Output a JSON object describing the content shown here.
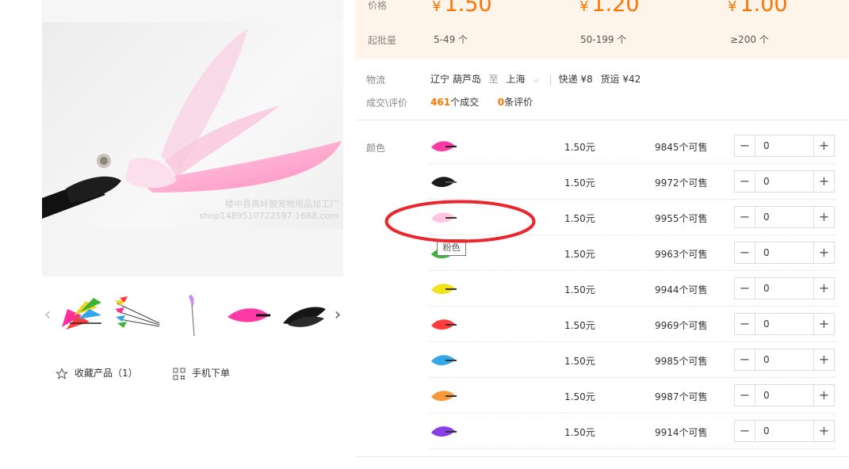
{
  "gallery": {
    "watermark_line1": "楼中县高岭狼宠物用品加工厂",
    "watermark_line2": "shop1489510722597.1688.com",
    "thumbnails": [
      {
        "name": "thumb-feather-bunch-pink"
      },
      {
        "name": "thumb-feather-bunch-mixed"
      },
      {
        "name": "thumb-feather-white"
      },
      {
        "name": "thumb-feather-pink"
      },
      {
        "name": "thumb-feather-black"
      }
    ]
  },
  "actions": {
    "favorite_label": "收藏产品（1）",
    "mobile_order_label": "手机下单"
  },
  "price_block": {
    "price_label": "价格",
    "moq_label": "起批量",
    "yen_symbol": "¥",
    "tiers": [
      {
        "price": "1.50",
        "range": "5-49 个"
      },
      {
        "price": "1.20",
        "range": "50-199 个"
      },
      {
        "price": "1.00",
        "range": "≥200 个"
      }
    ]
  },
  "logistics": {
    "label": "物流",
    "origin": "辽宁 葫芦岛",
    "to": "至",
    "destination": "上海",
    "express": "快递 ¥8",
    "freight": "货运 ¥42"
  },
  "deals": {
    "label": "成交\\评价",
    "count": "461",
    "count_suffix": "个成交",
    "reviews": "0",
    "reviews_suffix": "条评价"
  },
  "sku": {
    "label": "颜色",
    "tooltip": "粉色",
    "plus": "+",
    "minus": "−",
    "rows": [
      {
        "price": "1.50元",
        "stock": "9845个可售",
        "qty": "0",
        "color": "#ff3aa6",
        "tip": "#222"
      },
      {
        "price": "1.50元",
        "stock": "9972个可售",
        "qty": "0",
        "color": "#1b1b1b",
        "tip": "#555"
      },
      {
        "price": "1.50元",
        "stock": "9955个可售",
        "qty": "0",
        "color": "#ffc6e2",
        "tip": "#333"
      },
      {
        "price": "1.50元",
        "stock": "9963个可售",
        "qty": "0",
        "color": "#3cb43c",
        "tip": "#333"
      },
      {
        "price": "1.50元",
        "stock": "9944个可售",
        "qty": "0",
        "color": "#f2e21a",
        "tip": "#333"
      },
      {
        "price": "1.50元",
        "stock": "9969个可售",
        "qty": "0",
        "color": "#ff3b3b",
        "tip": "#333"
      },
      {
        "price": "1.50元",
        "stock": "9985个可售",
        "qty": "0",
        "color": "#35a7e8",
        "tip": "#333"
      },
      {
        "price": "1.50元",
        "stock": "9987个可售",
        "qty": "0",
        "color": "#f79a3c",
        "tip": "#333"
      },
      {
        "price": "1.50元",
        "stock": "9914个可售",
        "qty": "0",
        "color": "#8a3ee8",
        "tip": "#333"
      }
    ]
  },
  "colors": {
    "accent": "#ff7300",
    "annotation": "#e8282e",
    "price_bg": "#fff4ea"
  }
}
